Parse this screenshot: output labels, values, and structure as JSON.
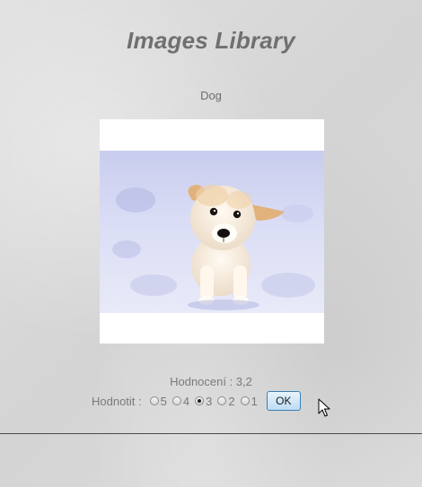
{
  "header": {
    "title": "Images Library"
  },
  "image": {
    "name": "Dog"
  },
  "rating": {
    "current_text": "Hodnocení : 3,2",
    "rate_label": "Hodnotit :",
    "options": [
      "5",
      "4",
      "3",
      "2",
      "1"
    ],
    "selected": "3",
    "ok_label": "OK"
  },
  "colors": {
    "background": "#dcdcdc",
    "title": "#707070",
    "text": "#7a7a7a",
    "button_border": "#3c7fb1",
    "button_fill": "#bcdcf4",
    "divider": "#4a4a4a"
  }
}
